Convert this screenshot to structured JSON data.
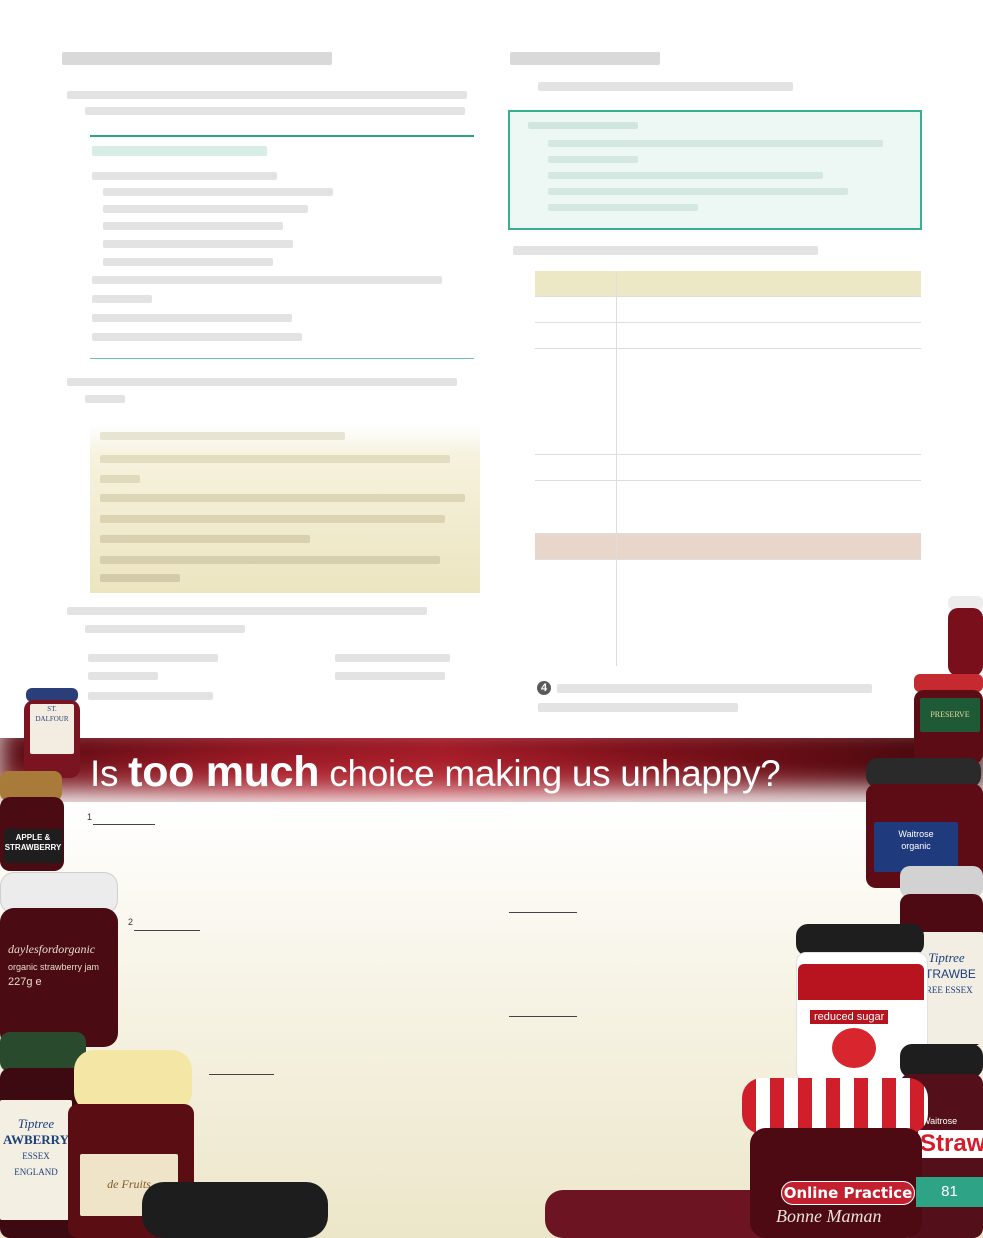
{
  "banner": {
    "title_pre": "Is",
    "title_bold": "too much",
    "title_post": "choice making us unhappy?"
  },
  "exercise_number": "4",
  "paragraph_numbers": [
    "1",
    "2"
  ],
  "jar_labels": {
    "dalfour": "ST. DALFOUR",
    "apple_strawberry": "APPLE & STRAWBERRY",
    "daylesford_1": "daylesfordorganic",
    "daylesford_2": "organic strawberry jam",
    "daylesford_3": "227g e",
    "tiptree_left_1": "Tiptree",
    "tiptree_left_2": "AWBERRY",
    "tiptree_left_3": "ESSEX ENGLAND",
    "rollos": "de Fruits",
    "waitrose_1": "Waitrose",
    "waitrose_2": "organic",
    "reduced_sugar": "reduced sugar",
    "tiptree_right_1": "Tiptree",
    "tiptree_right_2": "STRAWBE",
    "tiptree_right_3": "TREE ESSEX",
    "bonne_maman": "Bonne Maman",
    "strawb": "Strawb",
    "waitrose_right": "Waitrose",
    "preserve": "PRESERVE"
  },
  "footer": {
    "online_practice": "Online Practice",
    "page_number": "81"
  },
  "colors": {
    "accent_teal": "#2ea386",
    "banner_red": "#8e1520",
    "online_red": "#c2202f"
  }
}
